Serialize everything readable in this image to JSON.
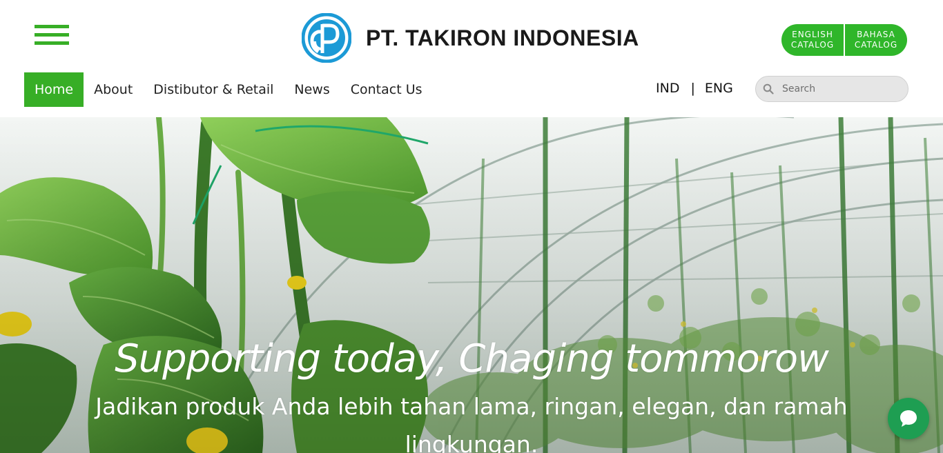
{
  "brand": {
    "name": "PT. TAKIRON INDONESIA",
    "logo_letters": "P",
    "color": "#1c9ad6"
  },
  "catalogs": {
    "english": {
      "line1": "ENGLISH",
      "line2": "CATALOG"
    },
    "bahasa": {
      "line1": "BAHASA",
      "line2": "CATALOG"
    }
  },
  "nav": {
    "items": [
      {
        "label": "Home",
        "active": true
      },
      {
        "label": "About"
      },
      {
        "label": "Distibutor & Retail"
      },
      {
        "label": "News"
      },
      {
        "label": "Contact Us"
      }
    ]
  },
  "lang": {
    "ind": "IND",
    "separator": "|",
    "eng": "ENG"
  },
  "search": {
    "placeholder": "Search",
    "value": ""
  },
  "hero": {
    "title": "Supporting today, Chaging tommorow",
    "subtitle": "Jadikan produk Anda lebih tahan lama, ringan, elegan, dan ramah lingkungan."
  },
  "colors": {
    "accent_green": "#37ae26",
    "catalog_green": "#2fb62a",
    "chat_green": "#1e9e52"
  },
  "icons": {
    "menu": "hamburger-icon",
    "search": "search-icon",
    "chat": "chat-bubble-icon"
  }
}
